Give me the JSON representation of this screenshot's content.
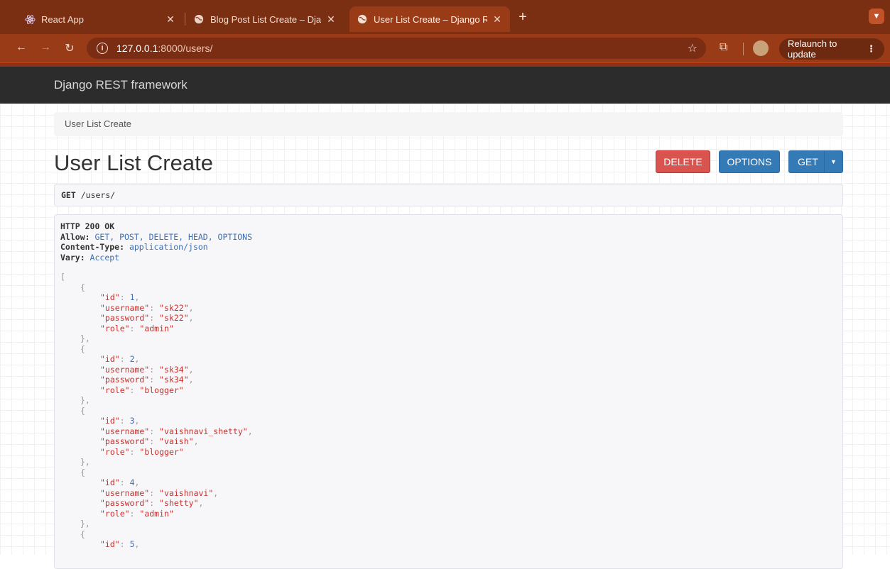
{
  "browser": {
    "tabs": [
      {
        "title": "React App",
        "favicon": "react-icon",
        "active": false
      },
      {
        "title": "Blog Post List Create – Django",
        "favicon": "globe-icon",
        "active": false
      },
      {
        "title": "User List Create – Django RES",
        "favicon": "globe-icon",
        "active": true
      }
    ],
    "url_host": "127.0.0.1",
    "url_path": ":8000/users/",
    "relaunch_label": "Relaunch to update",
    "new_tab_symbol": "+",
    "colors": {
      "frame": "#7a2f13",
      "toolbar": "#9a3b17"
    }
  },
  "drf": {
    "brand": "Django REST framework",
    "breadcrumb": "User List Create",
    "title": "User List Create",
    "buttons": {
      "delete": "DELETE",
      "options": "OPTIONS",
      "get": "GET"
    },
    "request": {
      "method": "GET",
      "path": "/users/"
    },
    "response": {
      "status": "HTTP 200 OK",
      "headers": [
        {
          "key": "Allow:",
          "value": "GET, POST, DELETE, HEAD, OPTIONS"
        },
        {
          "key": "Content-Type:",
          "value": "application/json"
        },
        {
          "key": "Vary:",
          "value": "Accept"
        }
      ],
      "users": [
        {
          "id": "1",
          "username": "\"sk22\"",
          "password": "\"sk22\"",
          "role": "\"admin\""
        },
        {
          "id": "2",
          "username": "\"sk34\"",
          "password": "\"sk34\"",
          "role": "\"blogger\""
        },
        {
          "id": "3",
          "username": "\"vaishnavi_shetty\"",
          "password": "\"vaish\"",
          "role": "\"blogger\""
        },
        {
          "id": "4",
          "username": "\"vaishnavi\"",
          "password": "\"shetty\"",
          "role": "\"admin\""
        },
        {
          "id": "5"
        }
      ]
    }
  }
}
